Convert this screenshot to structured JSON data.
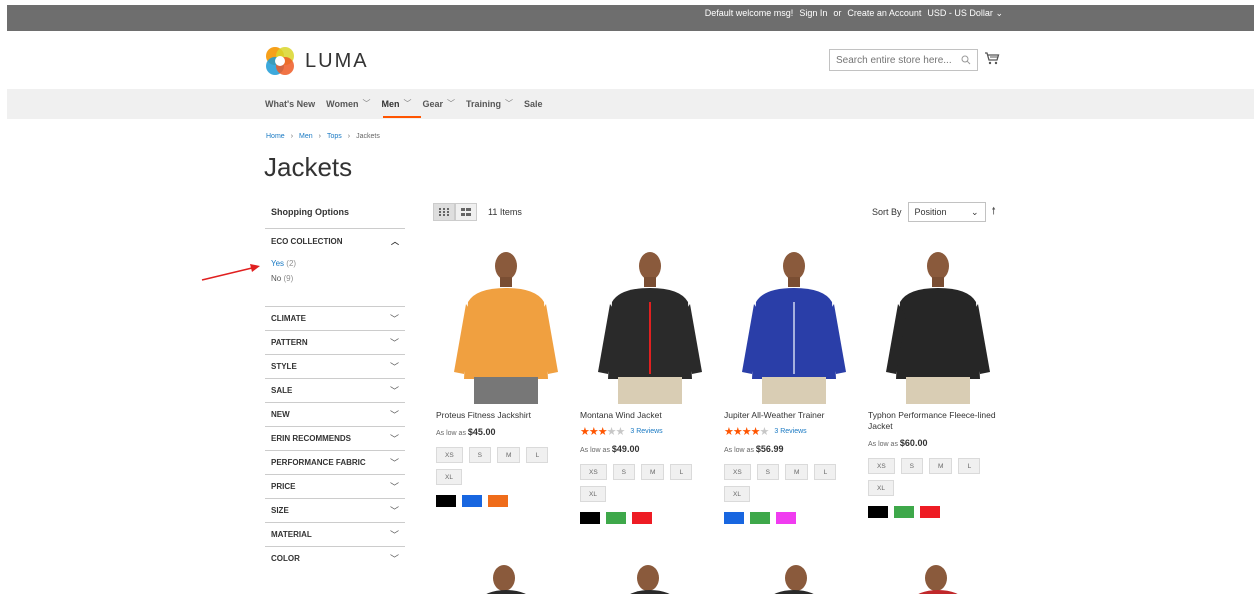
{
  "panel": {
    "welcome": "Default welcome msg!",
    "sign_in": "Sign In",
    "or": "or",
    "create_account": "Create an Account",
    "currency": "USD - US Dollar"
  },
  "header": {
    "logo_text": "LUMA",
    "search_placeholder": "Search entire store here..."
  },
  "nav": {
    "items": [
      {
        "label": "What's New"
      },
      {
        "label": "Women"
      },
      {
        "label": "Men"
      },
      {
        "label": "Gear"
      },
      {
        "label": "Training"
      },
      {
        "label": "Sale"
      }
    ]
  },
  "breadcrumbs": [
    "Home",
    "Men",
    "Tops",
    "Jackets"
  ],
  "page_title": "Jackets",
  "sidebar": {
    "title": "Shopping Options",
    "eco": {
      "label": "ECO COLLECTION",
      "options": [
        {
          "label": "Yes",
          "count": "(2)"
        },
        {
          "label": "No",
          "count": "(9)"
        }
      ]
    },
    "filters": [
      "CLIMATE",
      "PATTERN",
      "STYLE",
      "SALE",
      "NEW",
      "ERIN RECOMMENDS",
      "PERFORMANCE FABRIC",
      "PRICE",
      "SIZE",
      "MATERIAL",
      "COLOR"
    ]
  },
  "toolbar": {
    "count": "11 Items",
    "sort_label": "Sort By",
    "sort_value": "Position"
  },
  "products": [
    {
      "name": "Proteus Fitness Jackshirt",
      "price_prefix": "As low as",
      "price": "$45.00",
      "sizes": [
        "XS",
        "S",
        "M",
        "L",
        "XL"
      ],
      "colors": [
        "#000000",
        "#1866e0",
        "#ef6c1a"
      ],
      "jacket_color": "#f0a040"
    },
    {
      "name": "Montana Wind Jacket",
      "rating": 3,
      "reviews": "3 Reviews",
      "price_prefix": "As low as",
      "price": "$49.00",
      "sizes": [
        "XS",
        "S",
        "M",
        "L",
        "XL"
      ],
      "colors": [
        "#000000",
        "#3ea84a",
        "#ee1c24"
      ],
      "jacket_color": "#2a2a2a"
    },
    {
      "name": "Jupiter All-Weather Trainer",
      "rating": 4,
      "reviews": "3 Reviews",
      "price_prefix": "As low as",
      "price": "$56.99",
      "sizes": [
        "XS",
        "S",
        "M",
        "L",
        "XL"
      ],
      "colors": [
        "#1866e0",
        "#3ea84a",
        "#f03cf0"
      ],
      "jacket_color": "#2a3ea8"
    },
    {
      "name": "Typhon Performance Fleece-lined Jacket",
      "price_prefix": "As low as",
      "price": "$60.00",
      "sizes": [
        "XS",
        "S",
        "M",
        "L",
        "XL"
      ],
      "colors": [
        "#000000",
        "#3ea84a",
        "#ee1c24"
      ],
      "jacket_color": "#262626"
    }
  ]
}
